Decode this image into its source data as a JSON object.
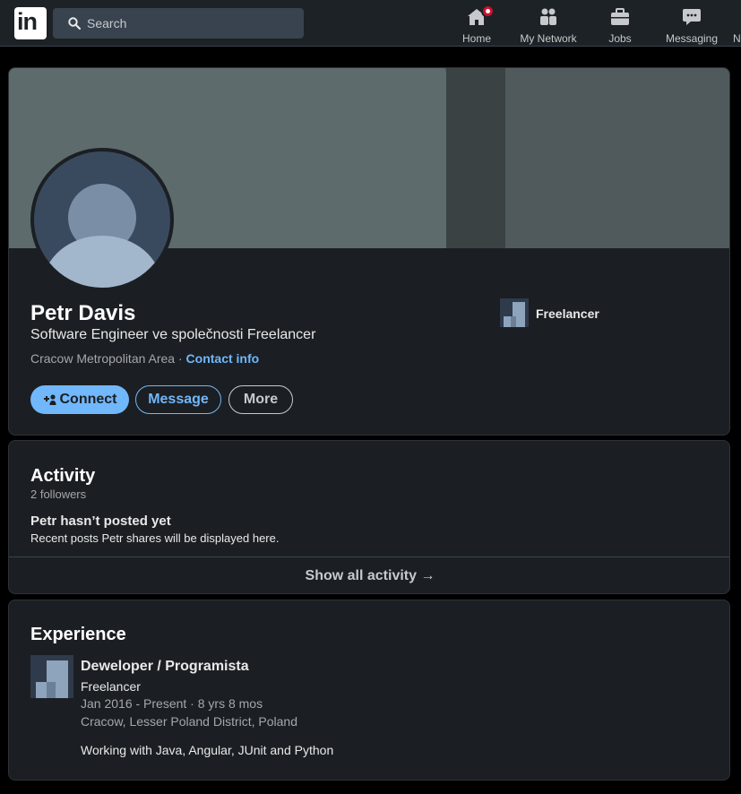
{
  "nav": {
    "search_placeholder": "Search",
    "items": [
      {
        "label": "Home",
        "icon": "home-icon"
      },
      {
        "label": "My Network",
        "icon": "people-icon"
      },
      {
        "label": "Jobs",
        "icon": "briefcase-icon"
      },
      {
        "label": "Messaging",
        "icon": "chat-icon"
      },
      {
        "label": "N",
        "icon": "bell-icon"
      }
    ]
  },
  "profile": {
    "name": "Petr Davis",
    "headline": "Software Engineer ve společnosti Freelancer",
    "location": "Cracow Metropolitan Area",
    "separator": " · ",
    "contact_label": "Contact info",
    "company": "Freelancer",
    "buttons": {
      "connect": "Connect",
      "message": "Message",
      "more": "More"
    }
  },
  "activity": {
    "title": "Activity",
    "followers": "2 followers",
    "empty_title": "Petr hasn’t posted yet",
    "empty_subtitle": "Recent posts Petr shares will be displayed here.",
    "show_all": "Show all activity →"
  },
  "experience": {
    "title": "Experience",
    "items": [
      {
        "title": "Deweloper / Programista",
        "company": "Freelancer",
        "dates": "Jan 2016 - Present · 8 yrs 8 mos",
        "location": "Cracow, Lesser Poland District, Poland",
        "description": "Working with Java, Angular, JUnit and Python"
      }
    ]
  },
  "colors": {
    "accent": "#71b7fb",
    "card_bg": "#1b1f23",
    "nav_bg": "#1d2226",
    "notification": "#cb112d"
  }
}
